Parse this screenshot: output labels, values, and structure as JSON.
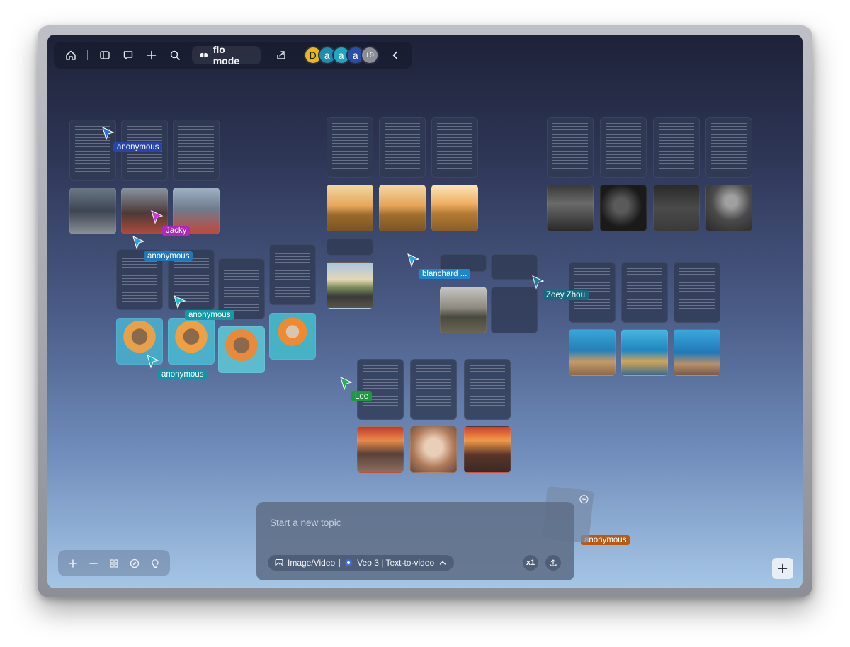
{
  "toolbar": {
    "mode_label": "flo mode",
    "home_icon": "home-icon",
    "sidebar_icon": "sidebar-icon",
    "chat_icon": "chat-icon",
    "add_icon": "plus-icon",
    "search_icon": "search-icon",
    "share_icon": "share-icon",
    "collapse_icon": "chevron-left-icon",
    "avatars": [
      {
        "label": "D",
        "color": "#e8b818"
      },
      {
        "label": "a",
        "color": "#1e8db0"
      },
      {
        "label": "a",
        "color": "#1ba8c0"
      },
      {
        "label": "a",
        "color": "#2a4fa8"
      }
    ],
    "more_count": "+9"
  },
  "collaborators": [
    {
      "name": "anonymous",
      "color": "#2f6fe0",
      "tag_bg": "#2746a8"
    },
    {
      "name": "Jacky",
      "color": "#c935d8",
      "tag_bg": "#b02ab8"
    },
    {
      "name": "anonymous",
      "color": "#2f9fe0",
      "tag_bg": "#2377b8"
    },
    {
      "name": "anonymous",
      "color": "#19c0c8",
      "tag_bg": "#129aa6"
    },
    {
      "name": "anonymous",
      "color": "#1eb6c8",
      "tag_bg": "#1494a8"
    },
    {
      "name": "blanchard ...",
      "color": "#2fa4e8",
      "tag_bg": "#1f86cc"
    },
    {
      "name": "Zoey Zhou",
      "color": "#1a7f96",
      "tag_bg": "#186a80"
    },
    {
      "name": "Lee",
      "color": "#22b04a",
      "tag_bg": "#1d9a3e"
    },
    {
      "name": "anonymous",
      "color": "#d06a1a",
      "tag_bg": "#b85a14"
    }
  ],
  "composer": {
    "placeholder": "Start a new topic",
    "media_label": "Image/Video",
    "model_label": "Veo 3 | Text-to-video",
    "count_label": "x1"
  },
  "zoom_controls": [
    "plus-icon",
    "minus-icon",
    "grid-icon",
    "compass-icon",
    "lightbulb-icon"
  ],
  "colors": {
    "bg_top": "#1e2238",
    "bg_bottom": "#a6c6e6",
    "card": "#303a54"
  }
}
